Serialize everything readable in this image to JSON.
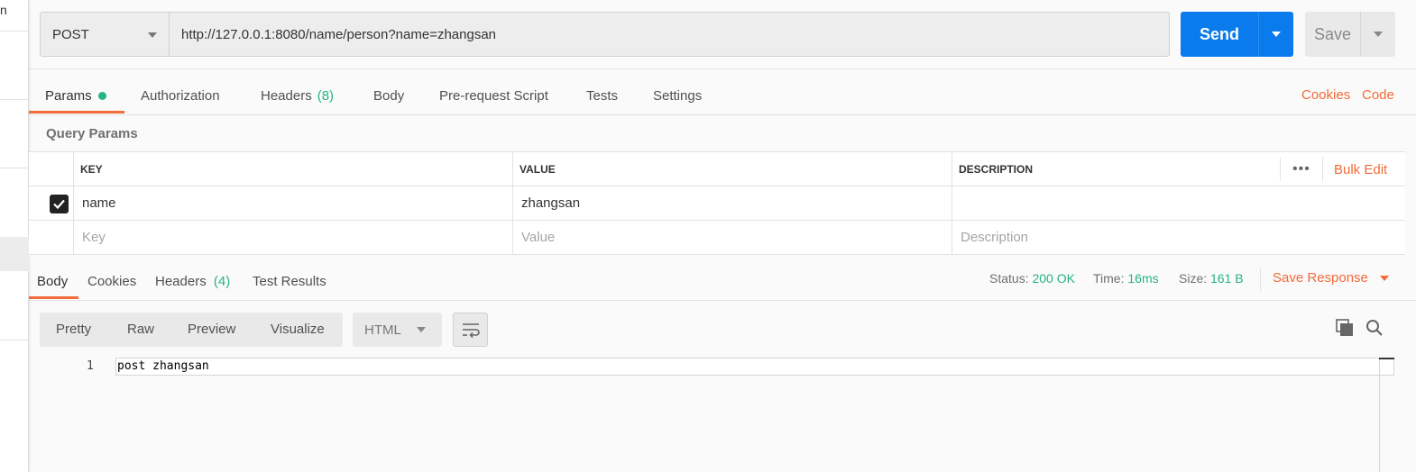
{
  "sidebar": {
    "fragment": "n"
  },
  "request": {
    "method": "POST",
    "url": "http://127.0.0.1:8080/name/person?name=zhangsan",
    "send_label": "Send",
    "save_label": "Save"
  },
  "request_tabs": [
    {
      "label": "Params"
    },
    {
      "label": "Authorization"
    },
    {
      "label": "Headers",
      "count": "(8)"
    },
    {
      "label": "Body"
    },
    {
      "label": "Pre-request Script"
    },
    {
      "label": "Tests"
    },
    {
      "label": "Settings"
    }
  ],
  "links": {
    "cookies": "Cookies",
    "code": "Code"
  },
  "query_params": {
    "title": "Query Params",
    "columns": {
      "key": "KEY",
      "value": "VALUE",
      "description": "DESCRIPTION"
    },
    "more": "•••",
    "bulk_edit": "Bulk Edit",
    "rows": [
      {
        "key": "name",
        "value": "zhangsan",
        "description": "",
        "checked": true
      }
    ],
    "placeholders": {
      "key": "Key",
      "value": "Value",
      "description": "Description"
    }
  },
  "response_tabs": [
    {
      "label": "Body"
    },
    {
      "label": "Cookies"
    },
    {
      "label": "Headers",
      "count": "(4)"
    },
    {
      "label": "Test Results"
    }
  ],
  "response_meta": {
    "status_label": "Status:",
    "status": "200 OK",
    "time_label": "Time:",
    "time": "16ms",
    "size_label": "Size:",
    "size": "161 B",
    "save_response": "Save Response"
  },
  "view": {
    "modes": [
      "Pretty",
      "Raw",
      "Preview",
      "Visualize"
    ],
    "format": "HTML"
  },
  "body": {
    "line_number": "1",
    "content": "post zhangsan"
  },
  "colors": {
    "accent": "#f26b3a",
    "send": "#097bed",
    "success": "#26b47f"
  }
}
